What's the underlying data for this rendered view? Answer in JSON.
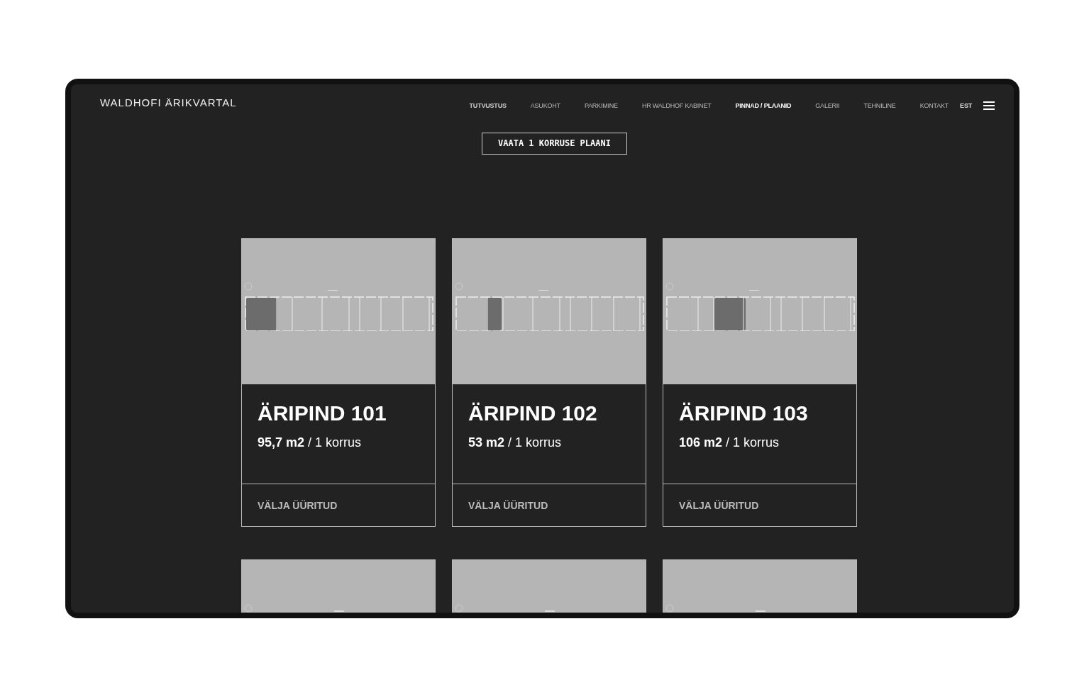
{
  "logo": "WALDHOFI ÄRIKVARTAL",
  "nav": [
    {
      "label": "TUTVUSTUS",
      "selected": false,
      "bold": true
    },
    {
      "label": "ASUKOHT",
      "selected": false,
      "bold": false
    },
    {
      "label": "PARKIMINE",
      "selected": false,
      "bold": false
    },
    {
      "label": "HR WALDHOF KABINET",
      "selected": false,
      "bold": false
    },
    {
      "label": "PINNAD / PLAANID",
      "selected": true,
      "bold": true
    },
    {
      "label": "GALERII",
      "selected": false,
      "bold": false
    },
    {
      "label": "TEHNILINE",
      "selected": false,
      "bold": false
    },
    {
      "label": "KONTAKT",
      "selected": false,
      "bold": false
    }
  ],
  "language": "EST",
  "floor_button": "VAATA 1 KORRUSE PLAANI",
  "units": [
    {
      "title": "ÄRIPIND 101",
      "area": "95,7 m2",
      "floor": "/ 1 korrus",
      "action": "VÄLJA ÜÜRITUD",
      "kind": "end"
    },
    {
      "title": "ÄRIPIND 102",
      "area": "53 m2",
      "floor": "/ 1 korrus",
      "action": "VÄLJA ÜÜRITUD",
      "kind": "second"
    },
    {
      "title": "ÄRIPIND 103",
      "area": "106 m2",
      "floor": "/ 1 korrus",
      "action": "VÄLJA ÜÜRITUD",
      "kind": "third"
    }
  ],
  "more_units": [
    {
      "kind": "plan"
    },
    {
      "kind": "plan"
    },
    {
      "kind": "plan"
    }
  ]
}
